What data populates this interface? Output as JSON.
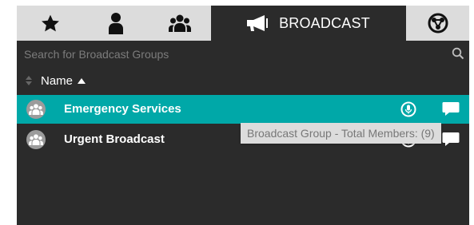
{
  "tabs": [
    {
      "icon": "star-icon"
    },
    {
      "icon": "person-icon"
    },
    {
      "icon": "group-icon"
    },
    {
      "icon": "megaphone-icon",
      "label": "BROADCAST",
      "active": true
    },
    {
      "icon": "network-icon"
    }
  ],
  "search": {
    "placeholder": "Search for Broadcast Groups",
    "icon": "search-icon"
  },
  "column_header": {
    "label": "Name",
    "sort": "ascending"
  },
  "rows": [
    {
      "name": "Emergency Services",
      "selected": true
    },
    {
      "name": "Urgent Broadcast",
      "selected": false
    }
  ],
  "tooltip": {
    "text": "Broadcast Group - Total Members: (9)"
  },
  "colors": {
    "panel": "#2b2b2b",
    "tabbar": "#dcdcdc",
    "selected": "#00a8a8"
  }
}
